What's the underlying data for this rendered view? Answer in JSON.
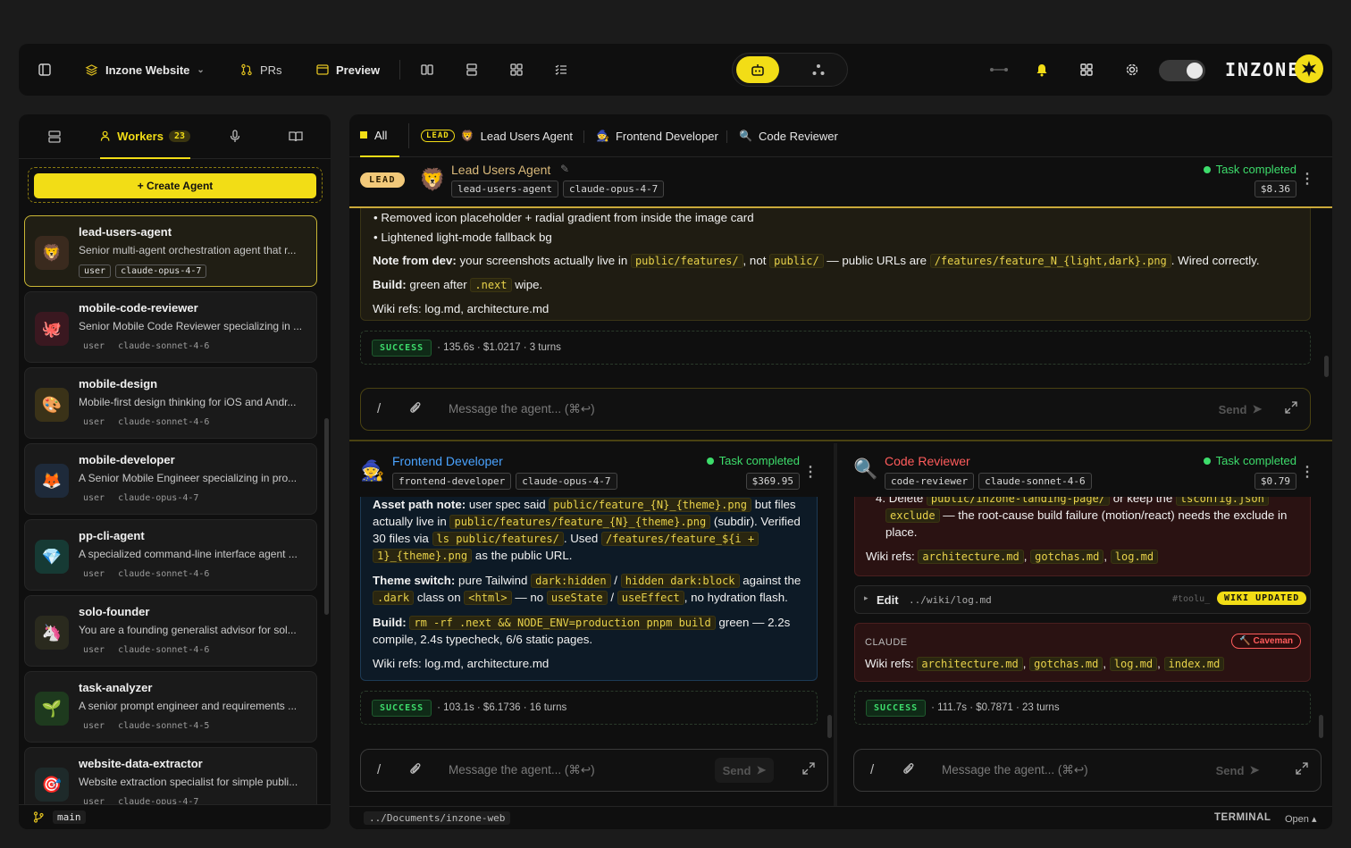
{
  "topbar": {
    "project": "Inzone Website",
    "prs": "PRs",
    "preview": "Preview",
    "brand": "INZONE"
  },
  "left": {
    "workers_label": "Workers",
    "workers_count": "23",
    "create_label": "+ Create Agent",
    "agents": [
      {
        "name": "lead-users-agent",
        "desc": "Senior multi-agent orchestration agent that r...",
        "tag1": "user",
        "tag2": "claude-opus-4-7",
        "icon": "lion-icon",
        "glyph": "🦁"
      },
      {
        "name": "mobile-code-reviewer",
        "desc": "Senior Mobile Code Reviewer specializing in ...",
        "tag1": "user",
        "tag2": "claude-sonnet-4-6",
        "icon": "octopus-icon",
        "glyph": "🐙"
      },
      {
        "name": "mobile-design",
        "desc": "Mobile-first design thinking for iOS and Andr...",
        "tag1": "user",
        "tag2": "claude-sonnet-4-6",
        "icon": "palette-icon",
        "glyph": "🎨"
      },
      {
        "name": "mobile-developer",
        "desc": "A Senior Mobile Engineer specializing in pro...",
        "tag1": "user",
        "tag2": "claude-opus-4-7",
        "icon": "fox-icon",
        "glyph": "🦊"
      },
      {
        "name": "pp-cli-agent",
        "desc": "A specialized command-line interface agent ...",
        "tag1": "user",
        "tag2": "claude-sonnet-4-6",
        "icon": "gem-icon",
        "glyph": "💎"
      },
      {
        "name": "solo-founder",
        "desc": "You are a founding generalist advisor for sol...",
        "tag1": "user",
        "tag2": "claude-sonnet-4-6",
        "icon": "unicorn-icon",
        "glyph": "🦄"
      },
      {
        "name": "task-analyzer",
        "desc": "A senior prompt engineer and requirements ...",
        "tag1": "user",
        "tag2": "claude-sonnet-4-5",
        "icon": "sprout-icon",
        "glyph": "🌱"
      },
      {
        "name": "website-data-extractor",
        "desc": "Website extraction specialist for simple publi...",
        "tag1": "user",
        "tag2": "claude-opus-4-7",
        "icon": "target-icon",
        "glyph": "🎯"
      }
    ],
    "branch": "main"
  },
  "filter_tabs": {
    "all": "All",
    "lead_pill": "LEAD",
    "lead_agent": "Lead Users Agent",
    "frontend": "Frontend Developer",
    "reviewer": "Code Reviewer"
  },
  "lead_panel": {
    "badge": "LEAD",
    "title": "Lead Users Agent",
    "chip1": "lead-users-agent",
    "chip2": "claude-opus-4-7",
    "status": "Task completed",
    "cost": "$8.36",
    "bullet1": "Removed icon placeholder + radial gradient from inside the image card",
    "bullet2": "Lightened light-mode fallback bg",
    "note_label": "Note from dev:",
    "note_text1": " your screenshots actually live in ",
    "note_code1": "public/features/",
    "note_text2": ", not ",
    "note_code2": "public/",
    "note_text3": " — public URLs are ",
    "note_code3": "/features/feature_N_{light,dark}.png",
    "note_text4": ". Wired correctly.",
    "build_label": "Build:",
    "build_text1": " green after ",
    "build_code": ".next",
    "build_text2": " wipe.",
    "wiki": "Wiki refs: log.md, architecture.md",
    "success": "SUCCESS",
    "stats": "· 135.6s  · $1.0217  · 3 turns",
    "placeholder": "Message the agent... (⌘↩)",
    "send": "Send"
  },
  "frontend_panel": {
    "title": "Frontend Developer",
    "chip1": "frontend-developer",
    "chip2": "claude-opus-4-7",
    "status": "Task completed",
    "cost": "$369.95",
    "l1_label": "Asset path note:",
    "l1_text": " user spec said ",
    "l1_code": "public/feature_{N}_{theme}.png",
    "l1_tail": " but files",
    "l2_text": "actually live in ",
    "l2_code": "public/features/feature_{N}_{theme}.png",
    "l2_tail": " (subdir). Verified",
    "l3_text": "30 files via ",
    "l3_code": "ls public/features/",
    "l3_mid": ". Used ",
    "l3_code2": "/features/feature_${i +",
    "l4_code": "1}_{theme}.png",
    "l4_tail": " as the public URL.",
    "l5_label": "Theme switch:",
    "l5_text": " pure Tailwind ",
    "l5_code1": "dark:hidden",
    "l5_slash": " / ",
    "l5_code2": "hidden dark:block",
    "l5_tail": " against the",
    "l6_code1": ".dark",
    "l6_text1": " class on ",
    "l6_code2": "<html>",
    "l6_text2": " — no ",
    "l6_code3": "useState",
    "l6_slash": " / ",
    "l6_code4": "useEffect",
    "l6_tail": ", no hydration flash.",
    "l7_label": "Build:",
    "l7_code": "rm -rf .next && NODE_ENV=production pnpm build",
    "l7_tail": " green — 2.2s",
    "l8": "compile, 2.4s typecheck, 6/6 static pages.",
    "wiki": "Wiki refs: log.md, architecture.md",
    "success": "SUCCESS",
    "stats": "· 103.1s  · $6.1736  · 16 turns",
    "placeholder": "Message the agent... (⌘↩)",
    "send": "Send"
  },
  "reviewer_panel": {
    "title": "Code Reviewer",
    "chip1": "code-reviewer",
    "chip2": "claude-sonnet-4-6",
    "status": "Task completed",
    "cost": "$0.79",
    "l0_text": "4. Delete ",
    "l0_code": "public/inzone-landing-page/",
    "l0_mid": " or keep the ",
    "l0_code2": "tsconfig.json",
    "l1_code": "exclude",
    "l1_tail": " — the root-cause build failure (motion/react) needs the exclude in",
    "l2": "place.",
    "wiki_label": "Wiki refs: ",
    "wiki1": "architecture.md",
    "wiki2": "gotchas.md",
    "wiki3": "log.md",
    "edit_label": "Edit",
    "edit_path": "../wiki/log.md",
    "edit_id": "#toolu_",
    "wiki_updated": "WIKI UPDATED",
    "claude_label": "CLAUDE",
    "caveman": "Caveman",
    "wiki4": "index.md",
    "success": "SUCCESS",
    "stats": "· 111.7s  · $0.7871  · 23 turns",
    "placeholder": "Message the agent... (⌘↩)",
    "send": "Send"
  },
  "statusbar": {
    "path": "../Documents/inzone-web",
    "terminal": "TERMINAL",
    "open": "Open ▴"
  },
  "colors": {
    "accent": "#f2dd16",
    "success": "#3ddc6b",
    "title_blue": "#4aa3ff",
    "title_gold": "#d9b97a",
    "title_red": "#ff5c5c"
  }
}
